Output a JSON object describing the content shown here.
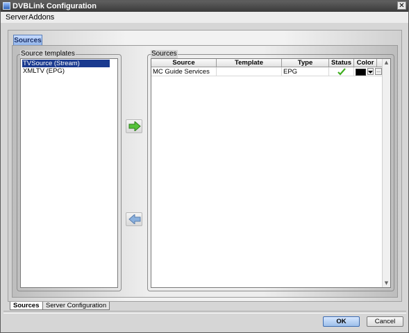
{
  "window": {
    "title": "DVBLink Configuration",
    "close_glyph": "✕"
  },
  "menu": {
    "items": [
      "Server",
      "Addons"
    ]
  },
  "top_tab": {
    "label": "Sources"
  },
  "source_templates": {
    "title": "Source templates",
    "items": [
      {
        "label": "TVSource (Stream)",
        "selected": true
      },
      {
        "label": "XMLTV (EPG)",
        "selected": false
      }
    ]
  },
  "buttons": {
    "add_icon": "right-arrow-icon",
    "remove_icon": "left-arrow-icon"
  },
  "sources": {
    "title": "Sources",
    "columns": [
      "Source",
      "Template",
      "Type",
      "Status",
      "Color"
    ],
    "rows": [
      {
        "source": "MC Guide Services",
        "template": "",
        "type": "EPG",
        "status_icon": "checkmark-icon",
        "color": "#000000",
        "more_label": "..."
      }
    ]
  },
  "bottom_tabs": [
    {
      "label": "Sources",
      "active": true
    },
    {
      "label": "Server Configuration",
      "active": false
    }
  ],
  "dialog_buttons": {
    "ok": "OK",
    "cancel": "Cancel"
  },
  "colors": {
    "selection": "#1a3a8f",
    "status_ok": "#3fae1f",
    "arrow_green": "#56c23a",
    "arrow_blue": "#8ab0dd"
  }
}
